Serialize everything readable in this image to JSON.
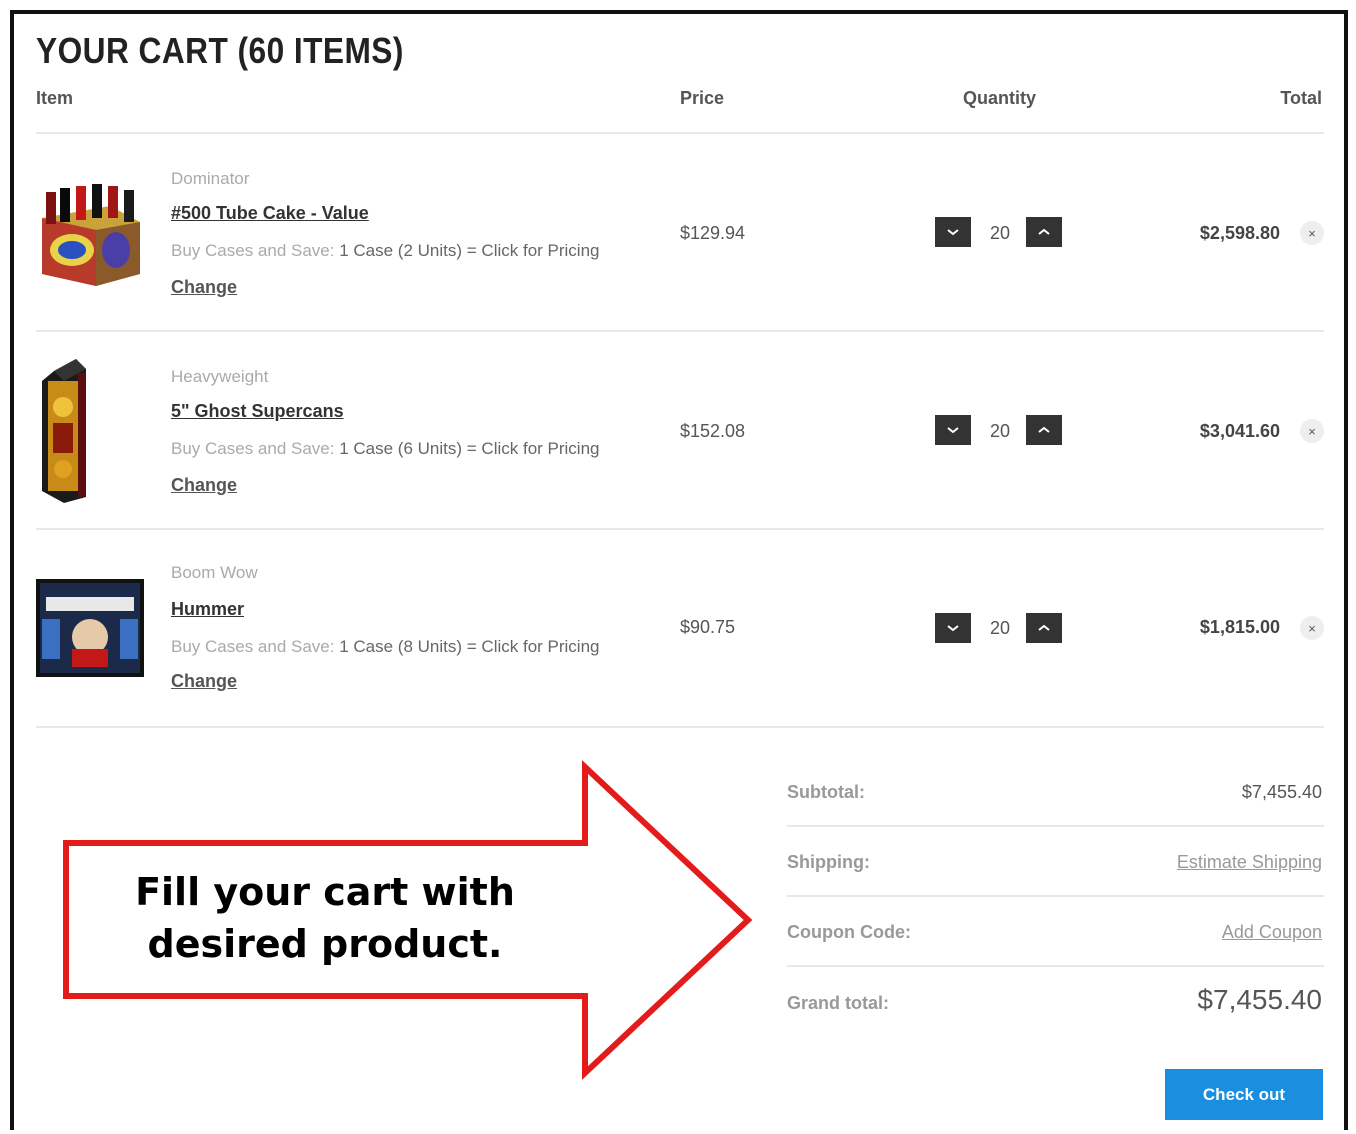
{
  "cart": {
    "title": "YOUR CART (60 ITEMS)",
    "columns": {
      "item": "Item",
      "price": "Price",
      "quantity": "Quantity",
      "total": "Total"
    },
    "items": [
      {
        "brand": "Dominator",
        "name": "#500 Tube Cake - Value",
        "save_label": "Buy Cases and Save:",
        "save_text": "1 Case (2 Units) = Click for Pricing",
        "change_label": "Change",
        "price": "$129.94",
        "quantity": "20",
        "total": "$2,598.80",
        "remove_label": "×"
      },
      {
        "brand": "Heavyweight",
        "name": "5\" Ghost Supercans",
        "save_label": "Buy Cases and Save:",
        "save_text": "1 Case (6 Units) = Click for Pricing",
        "change_label": "Change",
        "price": "$152.08",
        "quantity": "20",
        "total": "$3,041.60",
        "remove_label": "×"
      },
      {
        "brand": "Boom Wow",
        "name": "Hummer",
        "save_label": "Buy Cases and Save:",
        "save_text": "1 Case (8 Units) = Click for Pricing",
        "change_label": "Change",
        "price": "$90.75",
        "quantity": "20",
        "total": "$1,815.00",
        "remove_label": "×"
      }
    ]
  },
  "summary": {
    "subtotal_label": "Subtotal:",
    "subtotal_value": "$7,455.40",
    "shipping_label": "Shipping:",
    "shipping_link": "Estimate Shipping",
    "coupon_label": "Coupon Code:",
    "coupon_link": "Add Coupon",
    "grand_label": "Grand total:",
    "grand_value": "$7,455.40",
    "checkout_label": "Check out"
  },
  "callout": {
    "line1": "Fill your cart with",
    "line2": "desired product."
  },
  "colors": {
    "accent": "#1a8fe0",
    "callout_border": "#e31b1b",
    "quantity_button": "#333333"
  },
  "icons": {
    "decrease": "chevron-down-icon",
    "increase": "chevron-up-icon",
    "remove": "close-icon"
  }
}
